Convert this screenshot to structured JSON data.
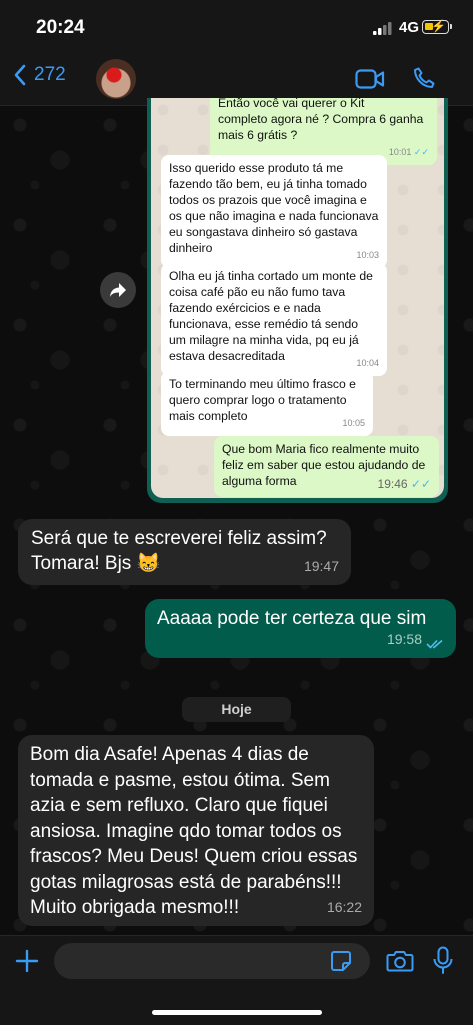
{
  "status": {
    "time": "20:24",
    "network": "4G"
  },
  "nav": {
    "back_count": "272"
  },
  "embedded": {
    "messages": [
      {
        "type": "out",
        "lines": [
          "Então você vai querer o Kit",
          "completo agora né ? Compra 6 ganha",
          "mais 6 grátis ?"
        ],
        "time": "10:01"
      },
      {
        "type": "in",
        "lines": [
          "Isso querido esse produto tá me",
          "fazendo tão bem, eu já tinha tomado",
          "todos os prazois que você imagina e",
          "os que não imagina e nada funcionava",
          "eu songastava dinheiro só gastava",
          "dinheiro"
        ],
        "time": "10:03"
      },
      {
        "type": "in",
        "lines": [
          "Olha eu já tinha cortado um monte de",
          "coisa café pão eu não fumo tava",
          "fazendo exércicios e e nada",
          "funcionava, esse remédio tá sendo",
          "um milagre na minha vida, pq eu já",
          "estava desacreditada"
        ],
        "time": "10:04"
      },
      {
        "type": "in",
        "lines": [
          "To terminando meu último frasco e",
          "quero comprar logo o tratamento",
          "mais completo"
        ],
        "time": "10:05"
      },
      {
        "type": "out",
        "lines": [
          "Que bom Maria fico realmente muito",
          "feliz em saber que estou ajudando de",
          "alguma forma"
        ],
        "time": "19:46"
      }
    ]
  },
  "chat": {
    "msg1": {
      "lines": [
        "Será que te escreverei feliz assim?",
        "Tomara! Bjs 😸"
      ],
      "time": "19:47"
    },
    "msg2": {
      "lines": [
        "Aaaaa pode ter certeza que sim"
      ],
      "time": "19:58"
    },
    "date_label": "Hoje",
    "msg3": {
      "lines": [
        "Bom dia Asafe! Apenas 4 dias de",
        "tomada e pasme, estou ótima. Sem",
        "azia e sem refluxo. Claro que fiquei",
        "ansiosa. Imagine qdo tomar todos os",
        "frascos? Meu Deus! Quem criou essas",
        "gotas milagrosas está de parabéns!!!",
        "Muito obrigada mesmo!!!"
      ],
      "time": "16:22"
    }
  },
  "colors": {
    "accent": "#3a9bf5",
    "incoming": "#262626",
    "outgoing": "#025c4b",
    "read_ticks": "#53bdeb"
  }
}
